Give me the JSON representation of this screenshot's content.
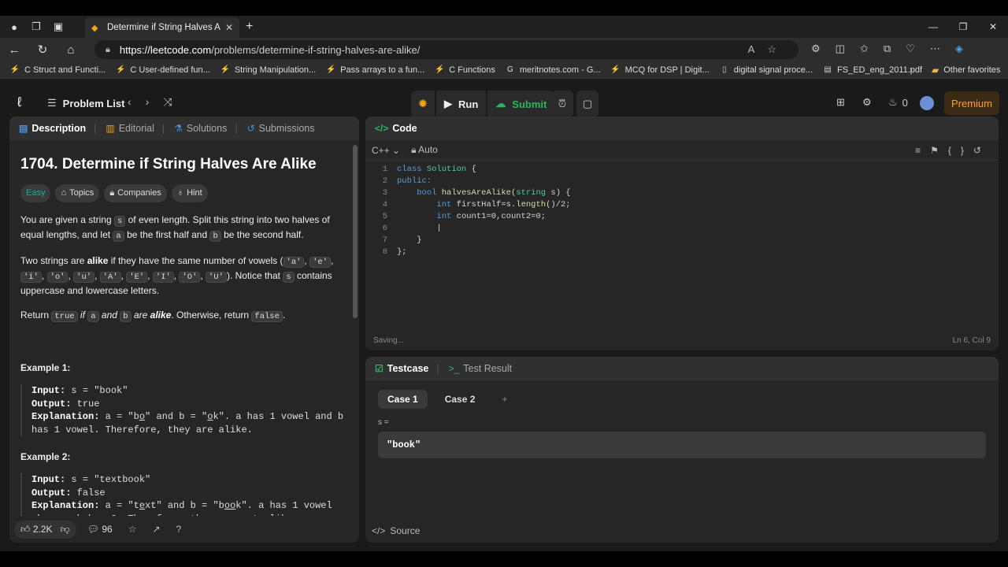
{
  "browser": {
    "tab_title": "Determine if String Halves Are Alike",
    "url_host": "https://leetcode.com",
    "url_path": "/problems/determine-if-string-halves-are-alike/",
    "bookmarks": [
      {
        "label": "C Struct and Functi...",
        "icon": "leetcode-icon"
      },
      {
        "label": "C User-defined fun...",
        "icon": "leetcode-icon"
      },
      {
        "label": "String Manipulation...",
        "icon": "leetcode-icon"
      },
      {
        "label": "Pass arrays to a fun...",
        "icon": "leetcode-icon"
      },
      {
        "label": "C Functions",
        "icon": "leetcode-icon"
      },
      {
        "label": "meritnotes.com - G...",
        "icon": "google-icon"
      },
      {
        "label": "MCQ for DSP | Digit...",
        "icon": "leetcode-icon"
      },
      {
        "label": "digital signal proce...",
        "icon": "file-icon"
      },
      {
        "label": "FS_ED_eng_2011.pdf",
        "icon": "pdf-icon"
      }
    ],
    "other_favorites": "Other favorites"
  },
  "lc": {
    "problem_list": "Problem List",
    "run": "Run",
    "submit": "Submit",
    "coins": "0",
    "premium": "Premium"
  },
  "left": {
    "tabs": [
      "Description",
      "Editorial",
      "Solutions",
      "Submissions"
    ],
    "title": "1704. Determine if String Halves Are Alike",
    "difficulty": "Easy",
    "chips": [
      "Topics",
      "Companies",
      "Hint"
    ],
    "example1_heading": "Example 1:",
    "example2_heading": "Example 2:",
    "likes": "2.2K",
    "comments": "96"
  },
  "editor": {
    "header": "Code",
    "language": "C++",
    "mode": "Auto",
    "status": "Saving...",
    "cursor": "Ln 6, Col 9"
  },
  "testcase": {
    "tab_active": "Testcase",
    "tab_other": "Test Result",
    "cases": [
      "Case 1",
      "Case 2"
    ],
    "var_label": "s =",
    "value": "\"book\"",
    "source": "Source"
  }
}
